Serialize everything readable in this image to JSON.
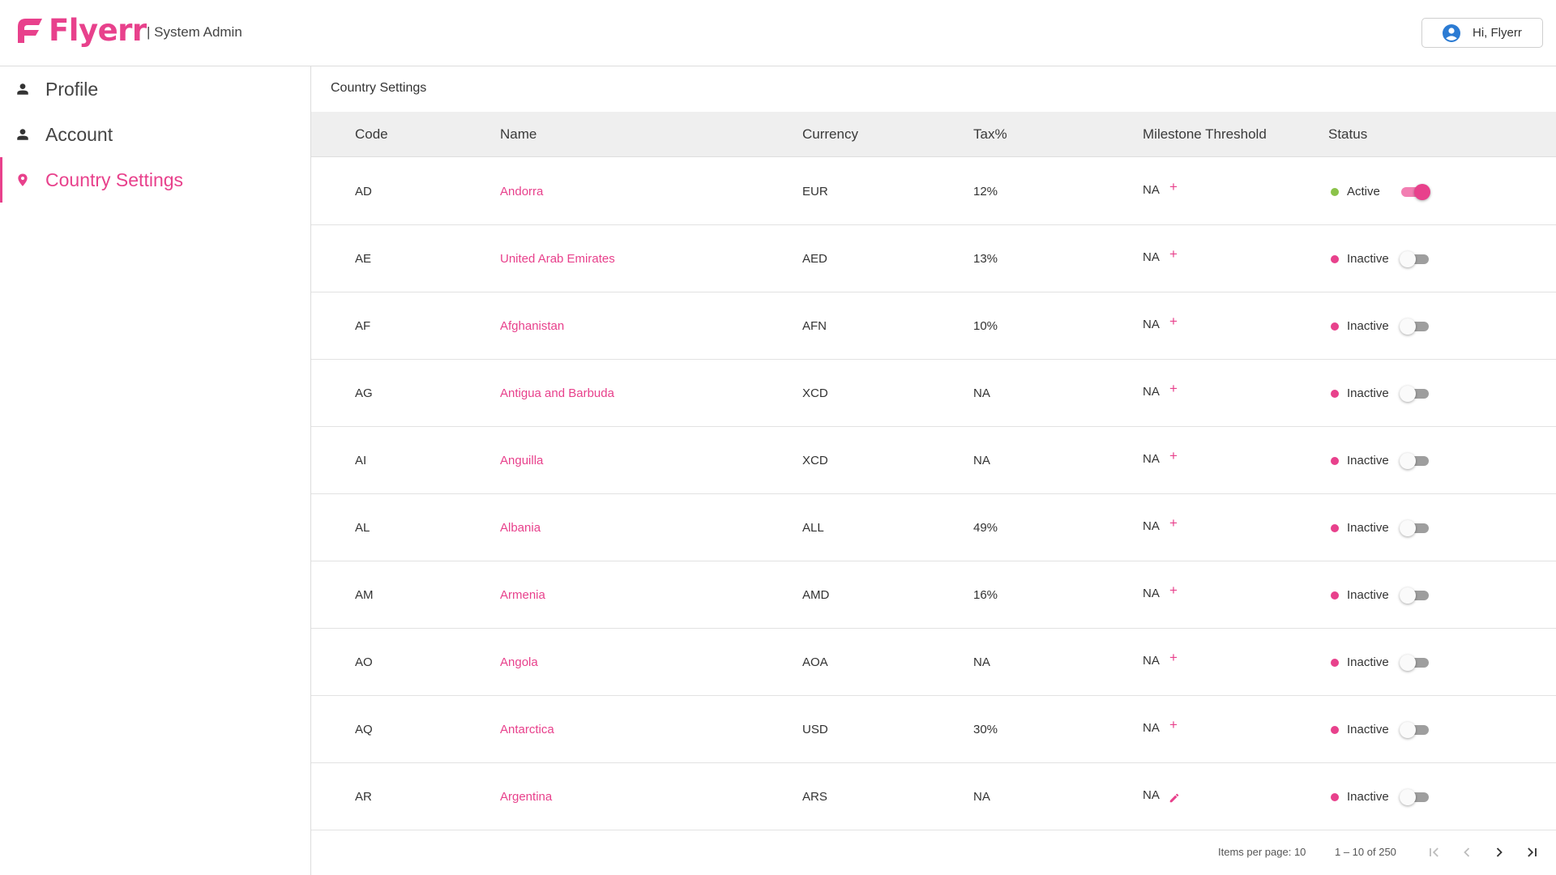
{
  "header": {
    "logo_text": "Flyerr",
    "subtitle": "| System Admin",
    "user_greeting": "Hi, Flyerr"
  },
  "sidebar": {
    "items": [
      {
        "label": "Profile",
        "icon": "person-icon",
        "active": false
      },
      {
        "label": "Account",
        "icon": "person-icon",
        "active": false
      },
      {
        "label": "Country Settings",
        "icon": "location-pin-icon",
        "active": true
      }
    ]
  },
  "main": {
    "title": "Country Settings",
    "columns": [
      "Code",
      "Name",
      "Currency",
      "Tax%",
      "Milestone Threshold",
      "Status"
    ],
    "rows": [
      {
        "code": "AD",
        "name": "Andorra",
        "currency": "EUR",
        "tax": "12%",
        "milestone": "NA",
        "milestone_action": "plus-icon",
        "status": "Active",
        "enabled": true
      },
      {
        "code": "AE",
        "name": "United Arab Emirates",
        "currency": "AED",
        "tax": "13%",
        "milestone": "NA",
        "milestone_action": "plus-icon",
        "status": "Inactive",
        "enabled": false
      },
      {
        "code": "AF",
        "name": "Afghanistan",
        "currency": "AFN",
        "tax": "10%",
        "milestone": "NA",
        "milestone_action": "plus-icon",
        "status": "Inactive",
        "enabled": false
      },
      {
        "code": "AG",
        "name": "Antigua and Barbuda",
        "currency": "XCD",
        "tax": "NA",
        "milestone": "NA",
        "milestone_action": "plus-icon",
        "status": "Inactive",
        "enabled": false
      },
      {
        "code": "AI",
        "name": "Anguilla",
        "currency": "XCD",
        "tax": "NA",
        "milestone": "NA",
        "milestone_action": "plus-icon",
        "status": "Inactive",
        "enabled": false
      },
      {
        "code": "AL",
        "name": "Albania",
        "currency": "ALL",
        "tax": "49%",
        "milestone": "NA",
        "milestone_action": "plus-icon",
        "status": "Inactive",
        "enabled": false
      },
      {
        "code": "AM",
        "name": "Armenia",
        "currency": "AMD",
        "tax": "16%",
        "milestone": "NA",
        "milestone_action": "plus-icon",
        "status": "Inactive",
        "enabled": false
      },
      {
        "code": "AO",
        "name": "Angola",
        "currency": "AOA",
        "tax": "NA",
        "milestone": "NA",
        "milestone_action": "plus-icon",
        "status": "Inactive",
        "enabled": false
      },
      {
        "code": "AQ",
        "name": "Antarctica",
        "currency": "USD",
        "tax": "30%",
        "milestone": "NA",
        "milestone_action": "plus-icon",
        "status": "Inactive",
        "enabled": false
      },
      {
        "code": "AR",
        "name": "Argentina",
        "currency": "ARS",
        "tax": "NA",
        "milestone": "NA",
        "milestone_action": "pencil-icon",
        "status": "Inactive",
        "enabled": false
      }
    ]
  },
  "paginator": {
    "items_per_page": "Items per page: 10",
    "range": "1 – 10 of 250"
  },
  "colors": {
    "accent": "#e8418c",
    "active_dot": "#8bc34a",
    "inactive_dot": "#e8418c",
    "header_bg": "#efefef"
  }
}
